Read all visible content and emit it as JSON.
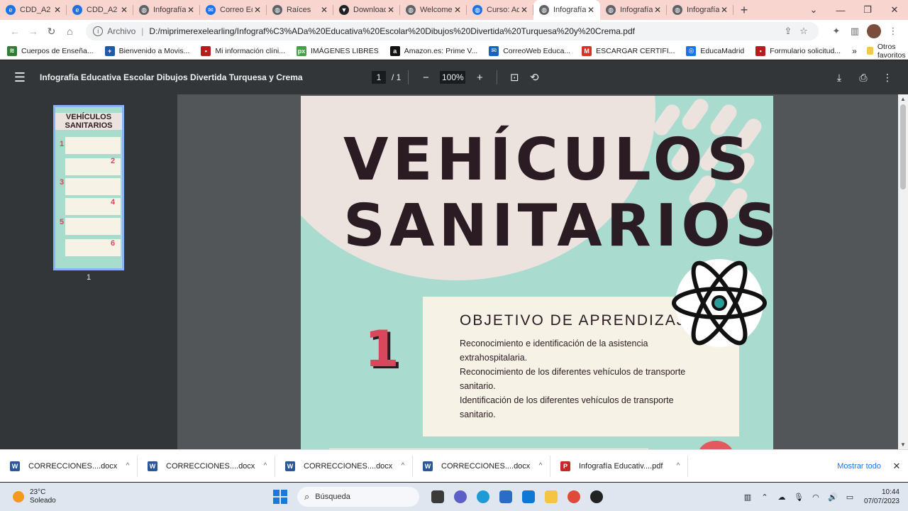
{
  "tabs": [
    {
      "title": "CDD_A2",
      "icon": "edge-icon",
      "color": "#1a73e8"
    },
    {
      "title": "CDD_A2",
      "icon": "edge-icon",
      "color": "#1a73e8"
    },
    {
      "title": "Infografía",
      "icon": "globe-icon",
      "color": "#5f6368"
    },
    {
      "title": "Correo Ed",
      "icon": "mail-icon",
      "color": "#1a73e8"
    },
    {
      "title": "Raíces",
      "icon": "globe-icon",
      "color": "#5f6368"
    },
    {
      "title": "Download",
      "icon": "download-icon",
      "color": "#202124"
    },
    {
      "title": "Welcome",
      "icon": "globe-icon",
      "color": "#5f6368"
    },
    {
      "title": "Curso: Ac",
      "icon": "globe-icon",
      "color": "#1a73e8"
    },
    {
      "title": "Infografía",
      "icon": "globe-icon",
      "color": "#5f6368",
      "active": true
    },
    {
      "title": "Infografía",
      "icon": "globe-icon",
      "color": "#5f6368"
    },
    {
      "title": "Infografía",
      "icon": "globe-icon",
      "color": "#5f6368"
    }
  ],
  "address": {
    "scheme": "Archivo",
    "url": "D:/miprimerexelearling/Infograf%C3%ADa%20Educativa%20Escolar%20Dibujos%20Divertida%20Turquesa%20y%20Crema.pdf"
  },
  "bookmarks": [
    {
      "label": "Cuerpos de Enseña...",
      "color": "#2e7d32",
      "glyph": "≋"
    },
    {
      "label": "Bienvenido a Movis...",
      "color": "#1e5aa8",
      "glyph": "+"
    },
    {
      "label": "Mi información clíni...",
      "color": "#b71c1c",
      "glyph": "▪"
    },
    {
      "label": "IMÁGENES LIBRES",
      "color": "#43a047",
      "glyph": "px"
    },
    {
      "label": "Amazon.es: Prime V...",
      "color": "#111111",
      "glyph": "a"
    },
    {
      "label": "CorreoWeb Educa...",
      "color": "#1565c0",
      "glyph": "✉"
    },
    {
      "label": "ESCARGAR CERTIFI...",
      "color": "#d93025",
      "glyph": "M"
    },
    {
      "label": "EducaMadrid",
      "color": "#1a73e8",
      "glyph": "◎"
    },
    {
      "label": "Formulario solicitud...",
      "color": "#b71c1c",
      "glyph": "▪"
    }
  ],
  "bookmarks_more": "»",
  "bookmarks_other": "Otros favoritos",
  "pdf": {
    "title": "Infografía Educativa Escolar Dibujos Divertida Turquesa y Crema",
    "page_current": "1",
    "page_total": "/   1",
    "zoom": "100%",
    "thumb_page_label": "1"
  },
  "thumbnail": {
    "title_line1": "VEHÍCULOS",
    "title_line2": "SANITARIOS",
    "numbers": [
      "1",
      "2",
      "3",
      "4",
      "5",
      "6"
    ]
  },
  "infographic": {
    "title_line1": "VEHÍCULOS",
    "title_line2": "SANITARIOS",
    "section_number": "1",
    "section_heading": "OBJETIVO DE APRENDIZAJE",
    "section_lines": [
      "Reconocimiento e identificación de la asistencia extrahospitalaria.",
      "Reconocimiento de los diferentes vehículos de transporte sanitario.",
      "Identificación de los diferentes vehículos de transporte sanitario."
    ],
    "colors": {
      "background": "#a9dccf",
      "blob": "#ece3df",
      "card": "#f6f2e6",
      "accent": "#d9475d",
      "ink": "#2b1b22"
    }
  },
  "downloads": [
    {
      "name": "CORRECCIONES....docx",
      "type": "word",
      "color": "#2b579a"
    },
    {
      "name": "CORRECCIONES....docx",
      "type": "word",
      "color": "#2b579a"
    },
    {
      "name": "CORRECCIONES....docx",
      "type": "word",
      "color": "#2b579a"
    },
    {
      "name": "CORRECCIONES....docx",
      "type": "word",
      "color": "#2b579a"
    },
    {
      "name": "Infografía Educativ....pdf",
      "type": "pdf",
      "color": "#c62828"
    }
  ],
  "downloads_show_all": "Mostrar todo",
  "taskbar": {
    "temperature": "23°C",
    "weather": "Soleado",
    "search_placeholder": "Búsqueda",
    "time": "10:44",
    "date": "07/07/2023"
  }
}
